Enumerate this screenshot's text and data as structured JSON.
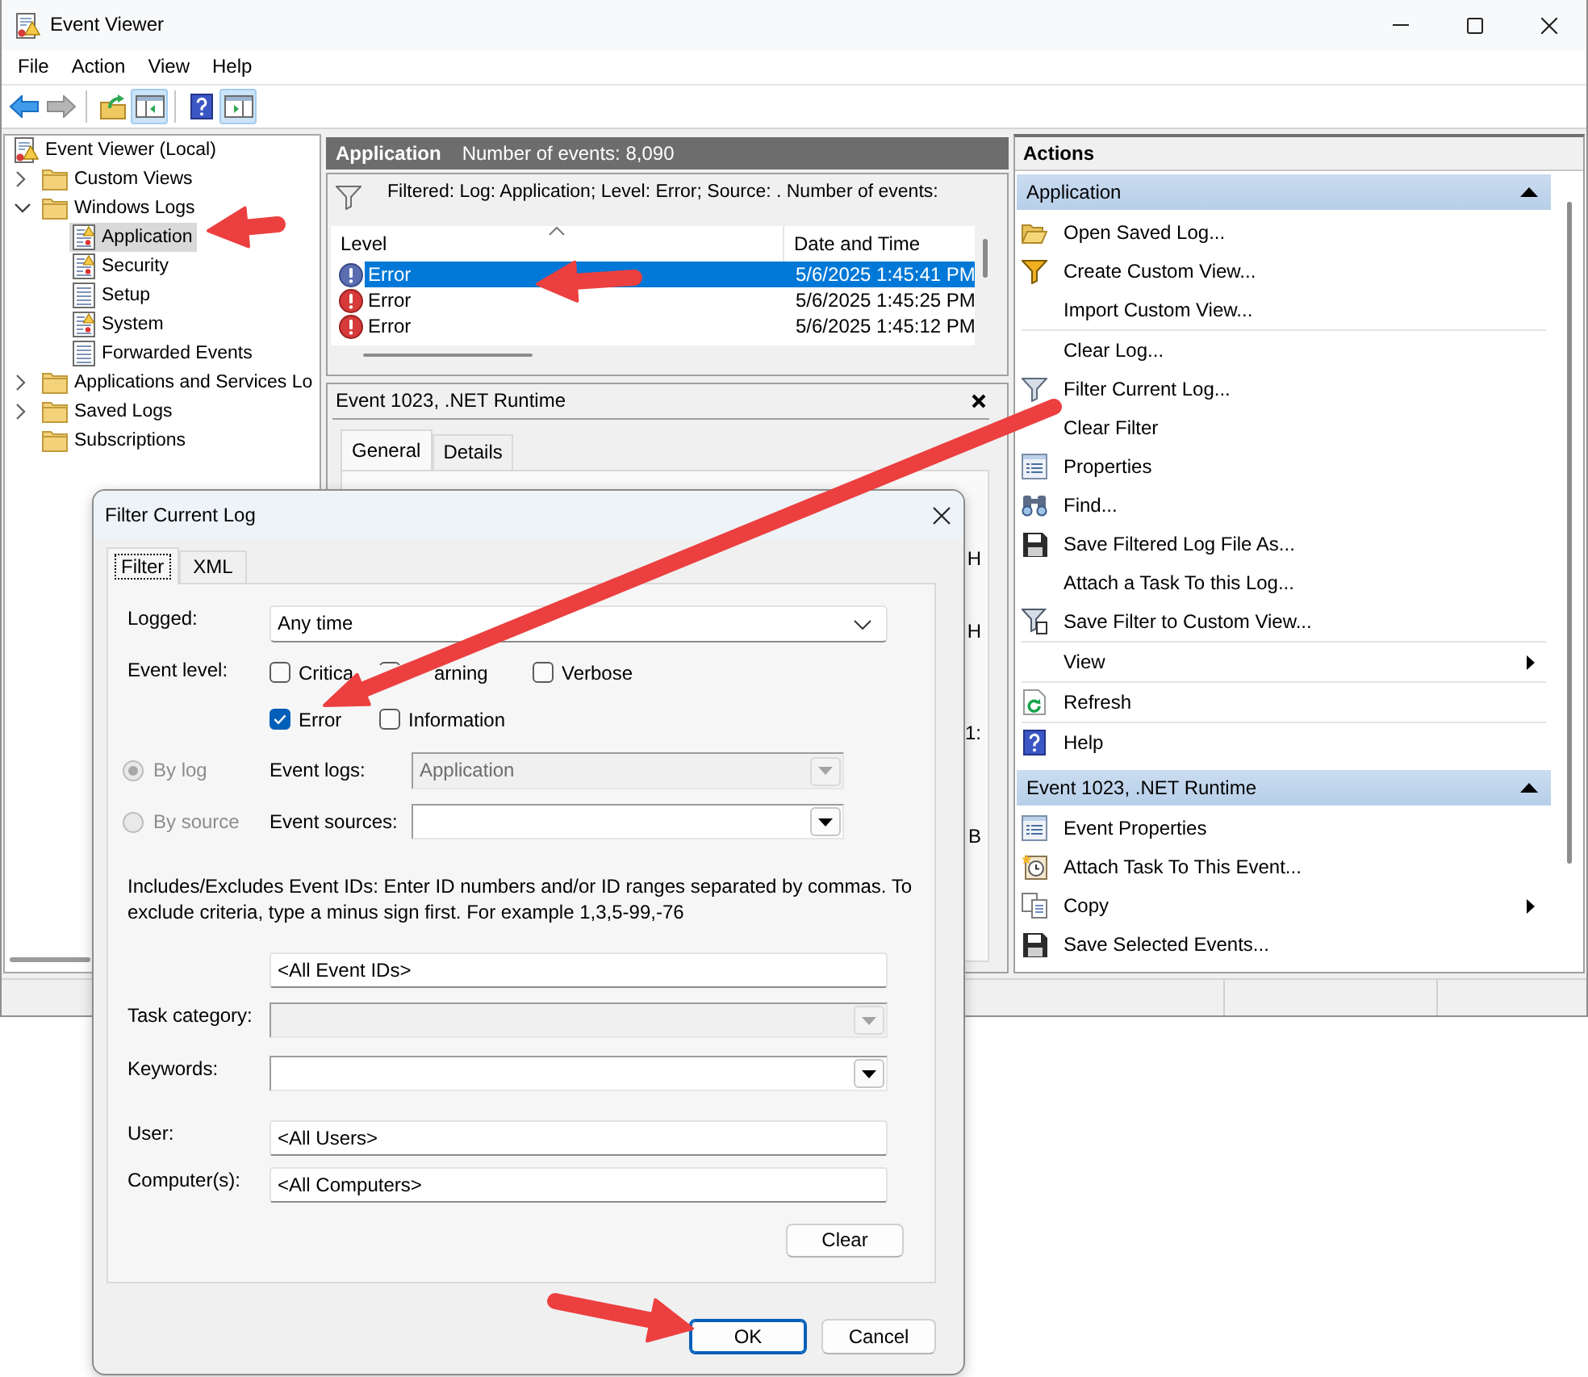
{
  "window": {
    "title": "Event Viewer",
    "menu": [
      "File",
      "Action",
      "View",
      "Help"
    ]
  },
  "toolbar": [
    {
      "pressed": false,
      "disabled": false
    },
    {
      "pressed": false,
      "disabled": true
    },
    {
      "pressed": false,
      "disabled": false
    },
    {
      "pressed": true,
      "disabled": false
    },
    {
      "pressed": false,
      "disabled": false
    },
    {
      "pressed": true,
      "disabled": false
    }
  ],
  "tree": {
    "label": "Event Viewer (Local)",
    "kind": "root",
    "selected": false,
    "children": [
      {
        "label": "Custom Views",
        "kind": "folder",
        "expanded": false,
        "selected": false
      },
      {
        "label": "Windows Logs",
        "kind": "folder",
        "expanded": true,
        "selected": false,
        "children": [
          {
            "label": "Application",
            "kind": "alert-log",
            "selected": true
          },
          {
            "label": "Security",
            "kind": "alert-log",
            "selected": false
          },
          {
            "label": "Setup",
            "kind": "log",
            "selected": false
          },
          {
            "label": "System",
            "kind": "alert-log",
            "selected": false
          },
          {
            "label": "Forwarded Events",
            "kind": "log",
            "selected": false
          }
        ]
      },
      {
        "label": "Applications and Services Lo",
        "kind": "folder",
        "expanded": false,
        "selected": false
      },
      {
        "label": "Saved Logs",
        "kind": "folder",
        "expanded": false,
        "selected": false
      },
      {
        "label": "Subscriptions",
        "kind": "folder",
        "selected": false
      }
    ]
  },
  "log_view": {
    "title": "Application",
    "event_count": "Number of events: 8,090",
    "filter_summary": "Filtered: Log: Application; Level: Error; Source: . Number of events:",
    "columns": [
      {
        "label": "Level",
        "sorted": true
      },
      {
        "label": "Date and Time",
        "sorted": false
      }
    ],
    "rows": [
      {
        "level": "Error",
        "date_time": "5/6/2025 1:45:41 PM",
        "selected": true
      },
      {
        "level": "Error",
        "date_time": "5/6/2025 1:45:25 PM",
        "selected": false
      },
      {
        "level": "Error",
        "date_time": "5/6/2025 1:45:12 PM",
        "selected": false
      }
    ]
  },
  "event_detail": {
    "title": "Event 1023, .NET Runtime",
    "tabs": [
      {
        "label": "General",
        "selected": true
      },
      {
        "label": "Details",
        "selected": false
      }
    ],
    "fragments": [
      "H",
      "H",
      "1:",
      "B"
    ]
  },
  "actions": {
    "title": "Actions",
    "sections": [
      {
        "title": "Application",
        "expanded": true,
        "groups": [
          {
            "items": [
              {
                "label": "Open Saved Log...",
                "kind": "command"
              },
              {
                "label": "Create Custom View...",
                "kind": "command"
              },
              {
                "label": "Import Custom View...",
                "kind": "command"
              }
            ]
          },
          {
            "items": [
              {
                "label": "Clear Log...",
                "kind": "command"
              },
              {
                "label": "Filter Current Log...",
                "kind": "command"
              },
              {
                "label": "Clear Filter",
                "kind": "command"
              },
              {
                "label": "Properties",
                "kind": "command"
              },
              {
                "label": "Find...",
                "kind": "command"
              },
              {
                "label": "Save Filtered Log File As...",
                "kind": "command"
              },
              {
                "label": "Attach a Task To this Log...",
                "kind": "command"
              },
              {
                "label": "Save Filter to Custom View...",
                "kind": "command"
              }
            ]
          },
          {
            "items": [
              {
                "label": "View",
                "kind": "submenu"
              }
            ]
          },
          {
            "items": [
              {
                "label": "Refresh",
                "kind": "command"
              }
            ]
          },
          {
            "items": [
              {
                "label": "Help",
                "kind": "command"
              }
            ]
          }
        ]
      },
      {
        "title": "Event 1023, .NET Runtime",
        "expanded": true,
        "groups": [
          {
            "items": [
              {
                "label": "Event Properties",
                "kind": "command"
              },
              {
                "label": "Attach Task To This Event...",
                "kind": "command"
              },
              {
                "label": "Copy",
                "kind": "submenu"
              },
              {
                "label": "Save Selected Events...",
                "kind": "command"
              }
            ]
          }
        ]
      }
    ]
  },
  "dialog": {
    "title": "Filter Current Log",
    "tabs": [
      {
        "label": "Filter",
        "selected": true
      },
      {
        "label": "XML",
        "selected": false
      }
    ],
    "logged": {
      "label": "Logged:",
      "value": "Any time"
    },
    "event_level": {
      "label": "Event level:",
      "options": [
        {
          "label": "Critica",
          "checked": false
        },
        {
          "label": "arning",
          "checked": false
        },
        {
          "label": "Verbose",
          "checked": false
        },
        {
          "label": "Error",
          "checked": true
        },
        {
          "label": "Information",
          "checked": false
        }
      ]
    },
    "source_modes": [
      {
        "label": "By log",
        "selected": true,
        "disabled": true
      },
      {
        "label": "By source",
        "selected": false,
        "disabled": true
      }
    ],
    "event_logs": {
      "label": "Event logs:",
      "value": "Application",
      "disabled": true
    },
    "event_sources": {
      "label": "Event sources:",
      "disabled": false
    },
    "ids_help": "Includes/Excludes Event IDs: Enter ID numbers and/or ID ranges separated by commas. To exclude criteria, type a minus sign first. For example 1,3,5-99,-76",
    "event_ids": {
      "value": "<All Event IDs>"
    },
    "task_category": {
      "label": "Task category:",
      "disabled": true
    },
    "keywords": {
      "label": "Keywords:",
      "disabled": false
    },
    "user": {
      "label": "User:",
      "value": "<All Users>"
    },
    "computers": {
      "label": "Computer(s):",
      "value": "<All Computers>"
    },
    "clear_button": "Clear",
    "buttons": [
      {
        "label": "OK",
        "default": true
      },
      {
        "label": "Cancel",
        "default": false
      }
    ]
  }
}
